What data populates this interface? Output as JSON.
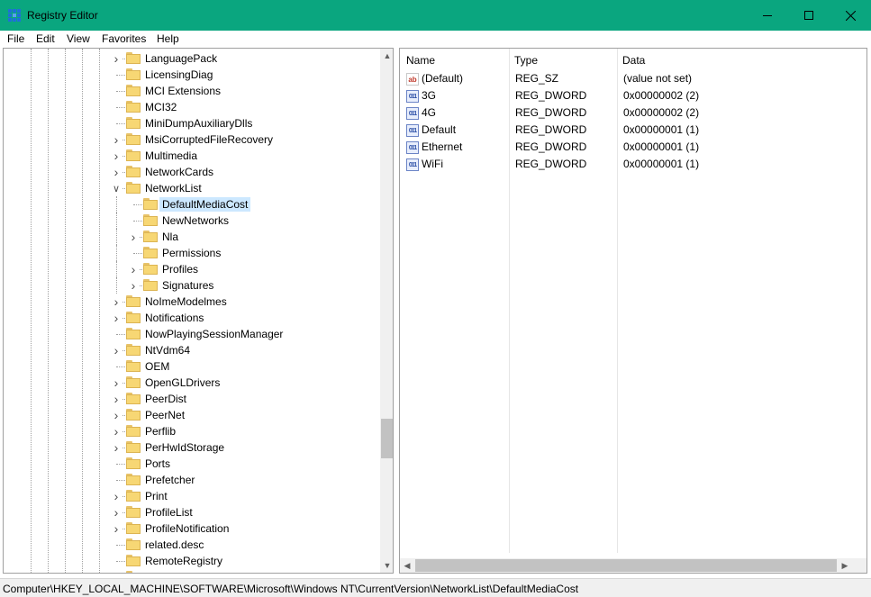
{
  "window": {
    "title": "Registry Editor",
    "accent_color": "#0aa67f"
  },
  "menu": {
    "items": [
      "File",
      "Edit",
      "View",
      "Favorites",
      "Help"
    ]
  },
  "tree": {
    "items": [
      {
        "label": "LanguagePack",
        "expander": ">"
      },
      {
        "label": "LicensingDiag",
        "expander": ""
      },
      {
        "label": "MCI Extensions",
        "expander": ""
      },
      {
        "label": "MCI32",
        "expander": ""
      },
      {
        "label": "MiniDumpAuxiliaryDlls",
        "expander": ""
      },
      {
        "label": "MsiCorruptedFileRecovery",
        "expander": ">"
      },
      {
        "label": "Multimedia",
        "expander": ">"
      },
      {
        "label": "NetworkCards",
        "expander": ">"
      },
      {
        "label": "NetworkList",
        "expander": "v"
      },
      {
        "label": "DefaultMediaCost",
        "expander": "",
        "selected": true
      },
      {
        "label": "NewNetworks",
        "expander": ""
      },
      {
        "label": "Nla",
        "expander": ">"
      },
      {
        "label": "Permissions",
        "expander": ""
      },
      {
        "label": "Profiles",
        "expander": ">"
      },
      {
        "label": "Signatures",
        "expander": ">"
      },
      {
        "label": "NoImeModelmes",
        "expander": ">"
      },
      {
        "label": "Notifications",
        "expander": ">"
      },
      {
        "label": "NowPlayingSessionManager",
        "expander": ""
      },
      {
        "label": "NtVdm64",
        "expander": ">"
      },
      {
        "label": "OEM",
        "expander": ""
      },
      {
        "label": "OpenGLDrivers",
        "expander": ">"
      },
      {
        "label": "PeerDist",
        "expander": ">"
      },
      {
        "label": "PeerNet",
        "expander": ">"
      },
      {
        "label": "Perflib",
        "expander": ">"
      },
      {
        "label": "PerHwIdStorage",
        "expander": ">"
      },
      {
        "label": "Ports",
        "expander": ""
      },
      {
        "label": "Prefetcher",
        "expander": ""
      },
      {
        "label": "Print",
        "expander": ">"
      },
      {
        "label": "ProfileList",
        "expander": ">"
      },
      {
        "label": "ProfileNotification",
        "expander": ">"
      },
      {
        "label": "related.desc",
        "expander": ""
      },
      {
        "label": "RemoteRegistry",
        "expander": ""
      },
      {
        "label": "SrvEdit",
        "expander": ">"
      }
    ]
  },
  "values": {
    "columns": {
      "name": "Name",
      "type": "Type",
      "data": "Data"
    },
    "rows": [
      {
        "icon": "string-value-icon",
        "name": "(Default)",
        "type": "REG_SZ",
        "data": "(value not set)"
      },
      {
        "icon": "dword-value-icon",
        "name": "3G",
        "type": "REG_DWORD",
        "data": "0x00000002 (2)"
      },
      {
        "icon": "dword-value-icon",
        "name": "4G",
        "type": "REG_DWORD",
        "data": "0x00000002 (2)"
      },
      {
        "icon": "dword-value-icon",
        "name": "Default",
        "type": "REG_DWORD",
        "data": "0x00000001 (1)"
      },
      {
        "icon": "dword-value-icon",
        "name": "Ethernet",
        "type": "REG_DWORD",
        "data": "0x00000001 (1)"
      },
      {
        "icon": "dword-value-icon",
        "name": "WiFi",
        "type": "REG_DWORD",
        "data": "0x00000001 (1)"
      }
    ]
  },
  "status": {
    "path": "Computer\\HKEY_LOCAL_MACHINE\\SOFTWARE\\Microsoft\\Windows NT\\CurrentVersion\\NetworkList\\DefaultMediaCost"
  }
}
